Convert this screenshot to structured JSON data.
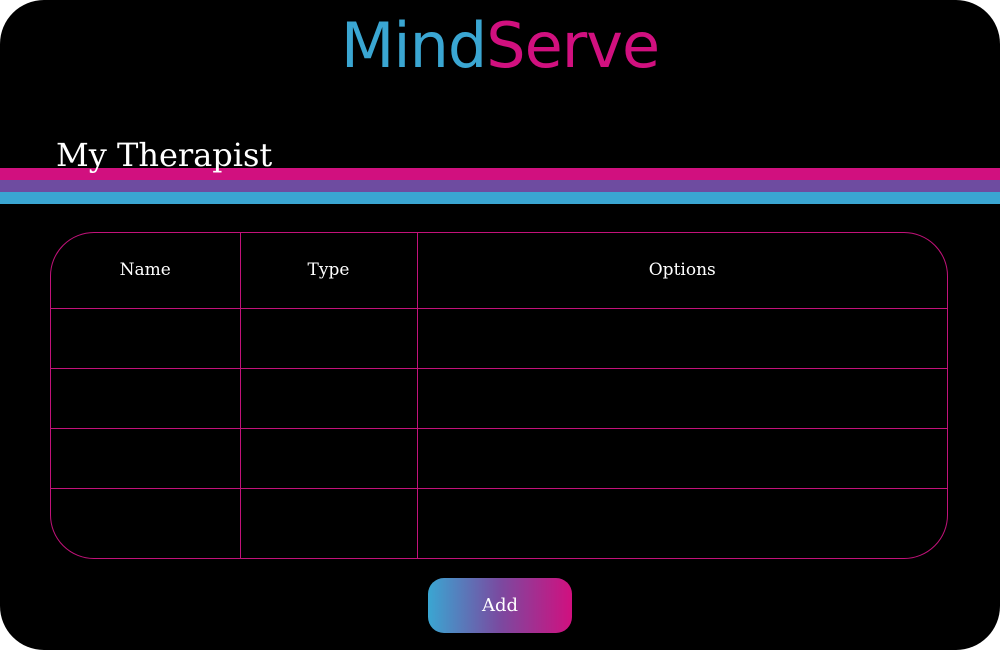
{
  "app": {
    "brand_part1": "Mind",
    "brand_part2": "Serve",
    "brand_color_1": "#3aa6d2",
    "brand_color_2": "#d1107f"
  },
  "page": {
    "title": "My Therapist"
  },
  "table": {
    "columns": [
      "Name",
      "Type",
      "Options"
    ],
    "rows": [
      [
        "",
        "",
        ""
      ],
      [
        "",
        "",
        ""
      ],
      [
        "",
        "",
        ""
      ],
      [
        "",
        "",
        ""
      ]
    ]
  },
  "actions": {
    "add_label": "Add"
  },
  "theme": {
    "background": "#000000",
    "accent_pink": "#d1107f",
    "accent_purple": "#6e4ca0",
    "accent_blue": "#3aa6d2"
  }
}
